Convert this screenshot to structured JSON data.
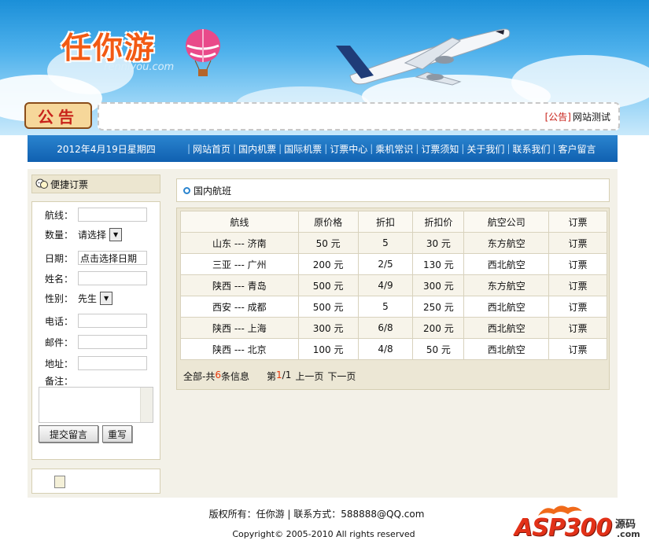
{
  "header": {
    "logo_text": "任你游",
    "logo_sub": "renniyou.com",
    "notice_label": "公告",
    "notice_tag": "[公告]",
    "notice_text": "网站测试"
  },
  "nav": {
    "date": "2012年4月19日星期四",
    "items": [
      "网站首页",
      "国内机票",
      "国际机票",
      "订票中心",
      "乘机常识",
      "订票须知",
      "关于我们",
      "联系我们",
      "客户留言"
    ]
  },
  "sidebar": {
    "title": "便捷订票",
    "route_label": "航线：",
    "qty_label": "数量：",
    "qty_value": "请选择",
    "date_label": "日期：",
    "date_value": "点击选择日期",
    "name_label": "姓名：",
    "gender_label": "性别：",
    "gender_value": "先生",
    "phone_label": "电话：",
    "email_label": "邮件：",
    "address_label": "地址：",
    "note_label": "备注：",
    "submit_label": "提交留言",
    "reset_label": "重写"
  },
  "main": {
    "title": "国内航班",
    "columns": [
      "航线",
      "原价格",
      "折扣",
      "折扣价",
      "航空公司",
      "订票"
    ],
    "rows": [
      [
        "山东 --- 济南",
        "50 元",
        "5",
        "30 元",
        "东方航空",
        "订票"
      ],
      [
        "三亚 --- 广州",
        "200 元",
        "2/5",
        "130 元",
        "西北航空",
        "订票"
      ],
      [
        "陕西 --- 青岛",
        "500 元",
        "4/9",
        "300 元",
        "东方航空",
        "订票"
      ],
      [
        "西安 --- 成都",
        "500 元",
        "5",
        "250 元",
        "西北航空",
        "订票"
      ],
      [
        "陕西 --- 上海",
        "300 元",
        "6/8",
        "200 元",
        "西北航空",
        "订票"
      ],
      [
        "陕西 --- 北京",
        "100 元",
        "4/8",
        "50 元",
        "西北航空",
        "订票"
      ]
    ],
    "pager": {
      "prefix": "全部-共",
      "count": "6",
      "suffix": "条信息",
      "page_prefix": "第",
      "page_current": "1",
      "page_total": "/1",
      "prev": "上一页",
      "next": "下一页"
    }
  },
  "footer": {
    "line1": "版权所有：任你游 | 联系方式：588888@QQ.com",
    "line2": "Copyright© 2005-2010 All rights reserved",
    "watermark_main": "ASP300",
    "watermark_side": "源码",
    "watermark_com": ".com"
  },
  "colors": {
    "nav_blue": "#1a6fc2",
    "content_bg": "#f3f1e8",
    "accent_red": "#e8390b",
    "logo_orange": "#f25a14"
  }
}
